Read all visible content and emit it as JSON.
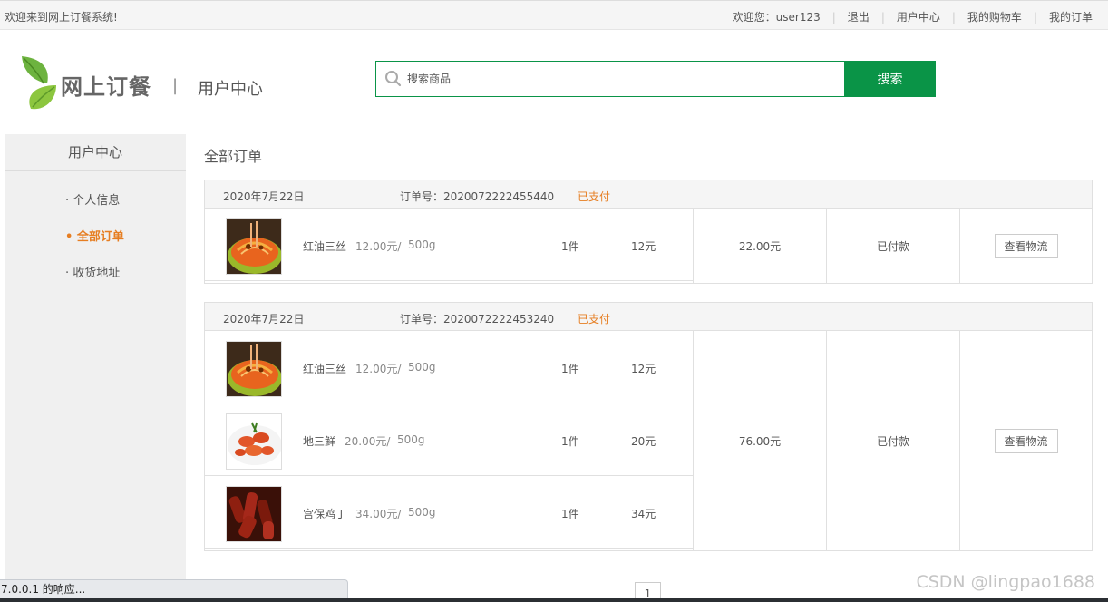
{
  "topbar": {
    "welcome": "欢迎来到网上订餐系统!",
    "greeting": "欢迎您：user123",
    "logout": "退出",
    "user_center": "用户中心",
    "cart": "我的购物车",
    "my_orders": "我的订单"
  },
  "header": {
    "logo_text": "网上订餐",
    "separator": "|",
    "title": "用户中心"
  },
  "search": {
    "placeholder": "搜索商品",
    "button": "搜索"
  },
  "sidebar": {
    "title": "用户中心",
    "items": [
      {
        "label": "· 个人信息",
        "active": false
      },
      {
        "label": "• 全部订单",
        "active": true
      },
      {
        "label": "· 收货地址",
        "active": false
      }
    ]
  },
  "main": {
    "title": "全部订单",
    "orders": [
      {
        "date": "2020年7月22日",
        "order_no": "订单号：2020072222455440",
        "status": "已支付",
        "items": [
          {
            "name": "红油三丝",
            "price": "12.00元/",
            "unit": "500g",
            "qty": "1件",
            "subtotal": "12元",
            "image": "noodle-dish"
          }
        ],
        "total": "22.00元",
        "payment": "已付款",
        "action": "查看物流"
      },
      {
        "date": "2020年7月22日",
        "order_no": "订单号：2020072222453240",
        "status": "已支付",
        "items": [
          {
            "name": "红油三丝",
            "price": "12.00元/",
            "unit": "500g",
            "qty": "1件",
            "subtotal": "12元",
            "image": "noodle-dish"
          },
          {
            "name": "地三鲜",
            "price": "20.00元/",
            "unit": "500g",
            "qty": "1件",
            "subtotal": "20元",
            "image": "shrimp-dish"
          },
          {
            "name": "宫保鸡丁",
            "price": "34.00元/",
            "unit": "500g",
            "qty": "1件",
            "subtotal": "34元",
            "image": "chicken-dish"
          }
        ],
        "total": "76.00元",
        "payment": "已付款",
        "action": "查看物流"
      }
    ]
  },
  "pager": {
    "page": "1"
  },
  "browser_status": "7.0.0.1 的响应...",
  "watermark": "CSDN @lingpao1688",
  "colors": {
    "brand_green": "#0a9447",
    "accent_orange": "#e67e22"
  }
}
